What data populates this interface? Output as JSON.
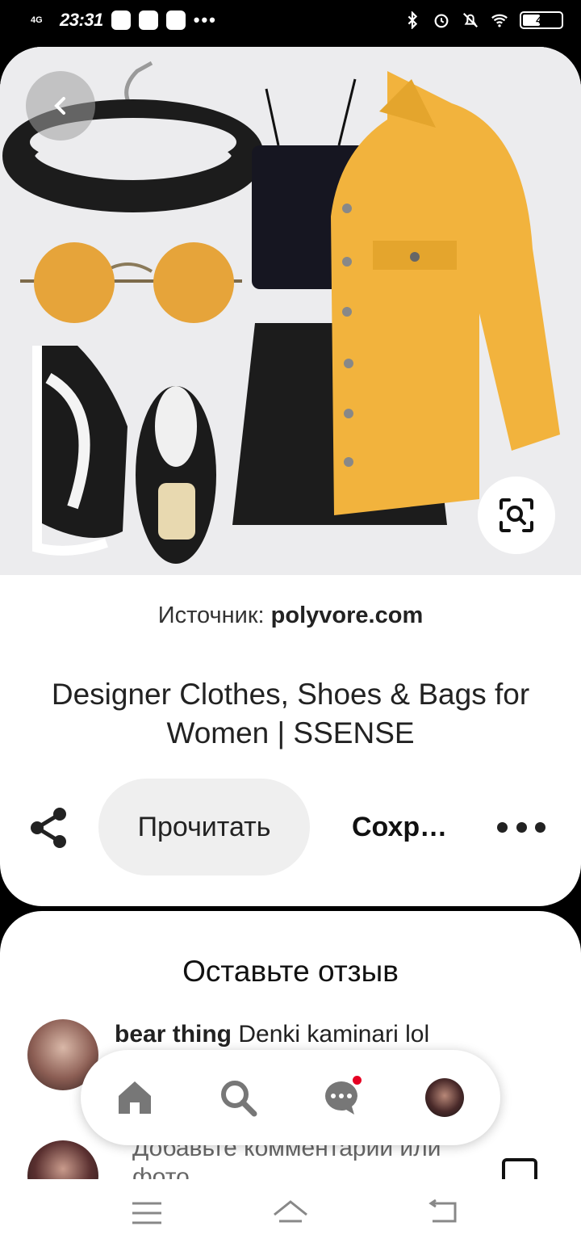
{
  "status_bar": {
    "network": "4G",
    "time": "23:31",
    "battery": "45",
    "battery_level": 0.45
  },
  "pin": {
    "source_label": "Источник:",
    "source_domain": "polyvore.com",
    "title": "Designer Clothes, Shoes & Bags for Women | SSENSE",
    "read_label": "Прочитать",
    "save_label": "Сохр…"
  },
  "comments": {
    "title": "Оставьте отзыв",
    "items": [
      {
        "author": "bear thing",
        "text": "Denki kaminari lol"
      }
    ],
    "input_placeholder": "Добавьте комментарий или фото"
  },
  "colors": {
    "accent_notification": "#e60023",
    "jacket": "#f2b33d",
    "lens_tint": "#e6a43a"
  },
  "icons": [
    "back-arrow-icon",
    "visual-search-icon",
    "share-icon",
    "more-icon",
    "home-icon",
    "search-icon",
    "messages-icon",
    "profile-avatar",
    "photo-icon",
    "menu-icon",
    "home-gesture-icon",
    "back-icon"
  ]
}
